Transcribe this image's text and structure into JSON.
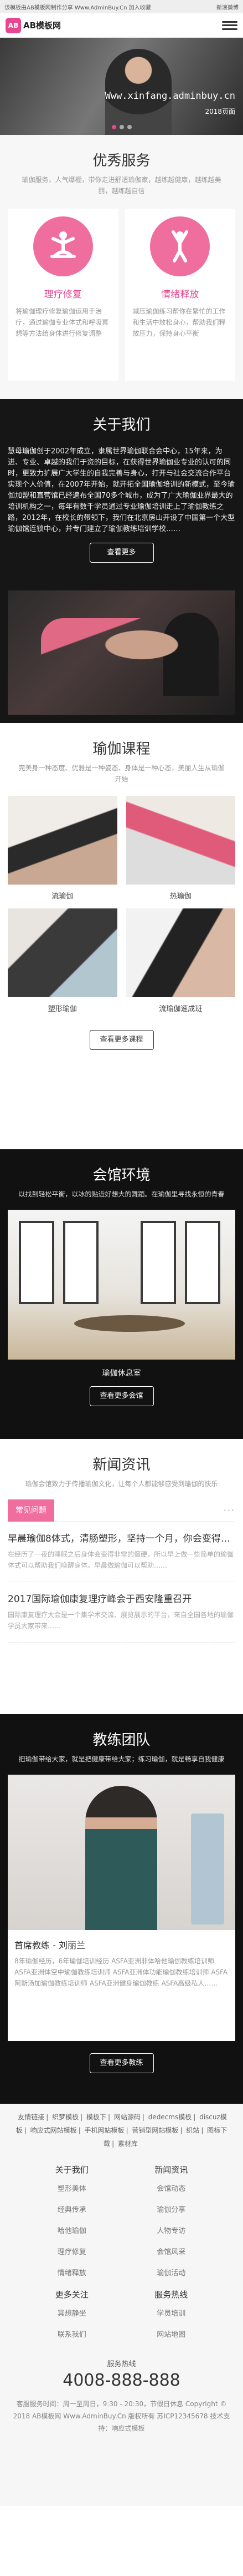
{
  "topbar": {
    "left": "该模板由AB模板网制作分享 Www.AdminBuy.Cn 加入收藏",
    "right": "新浪微博"
  },
  "header": {
    "logo_mark": "AB",
    "logo_text": "AB模板网"
  },
  "banner": {
    "url": "Www.xinfang.adminbuy.cn",
    "page": "2018页面"
  },
  "services": {
    "title": "优秀服务",
    "desc": "瑜伽服务，人气爆棚，带你走进舒适瑜伽家，越练越健康，越练越美丽，越练越自信",
    "items": [
      {
        "title": "理疗修复",
        "text": "将瑜伽理疗修复瑜伽运用于治疗，通过瑜伽专业体式和呼吸冥想等方法给身体进行修复调整"
      },
      {
        "title": "情绪释放",
        "text": "减压瑜伽练习帮你在繁忙的工作和生活中放松身心，帮助我们释放压力，保持身心平衡"
      }
    ]
  },
  "about": {
    "title": "关于我们",
    "text": "慧母瑜伽创于2002年成立，隶属世界瑜伽联合会中心，15年来，为进、专业、卓越的我们于资的目标，在获得世界瑜伽业专业的认可的同时，更致力扩展广大学生的自我完善与身心，打开与社会交流合作平台实现个人价值，在2007年开始，就开拓全国瑜伽培训的新模式，至今瑜伽加盟和直营馆已经遍布全国70多个城市，成为了广大瑜伽业界最大的培训机构之一，每年有数千学员通过专业瑜伽培训走上了瑜伽教练之路，2012年，在校长的带领下，我们在北京房山开设了中国第一个大型瑜伽馆连锁中心，并专门建立了瑜伽教练培训学校……",
    "button": "查看更多"
  },
  "courses": {
    "title": "瑜伽课程",
    "desc": "完美身一种态度、优雅是一种姿态、身体是一种心态，美丽人生从瑜伽开始",
    "items": [
      {
        "name": "流瑜伽"
      },
      {
        "name": "热瑜伽"
      },
      {
        "name": "塑形瑜伽"
      },
      {
        "name": "流瑜伽速成班"
      }
    ],
    "button": "查看更多课程"
  },
  "env": {
    "title": "会馆环境",
    "desc": "以找到轻松平衡，以冰的贴近好想大的舞蹈。在瑜伽里寻找永恒的青春",
    "caption": "瑜伽休息室",
    "button": "查看更多会馆"
  },
  "news": {
    "title": "新闻资讯",
    "desc": "瑜伽会馆致力于传播瑜伽文化，让每个人都能够感受到瑜伽的快乐",
    "tab": "常见问题",
    "more": "···",
    "items": [
      {
        "title": "早晨瑜伽8体式，清肠塑形，坚持一个月，你会变得更美",
        "desc": "在经历了一夜的睡眠之后身体会变得非常的僵硬，所以早上做一些简单的瑜伽体式可以帮助我们唤醒身体。早晨做瑜伽可以帮助……"
      },
      {
        "title": "2017国际瑜伽康复理疗峰会于西安隆重召开",
        "desc": "国际康复理疗大会是一个集学术交流、展览展示的平台，来自全国各地的瑜伽学员大家带来……"
      }
    ]
  },
  "team": {
    "title": "教练团队",
    "desc": "把瑜伽带给大家，就是把健康带给大家；练习瑜伽，就是畅享自我健康",
    "name": "首席教练 - 刘丽兰",
    "text": "8年瑜伽经历，6年瑜伽培训经历 ASFA亚洲非体哈他瑜伽教练培训师 ASFA亚洲体空中瑜伽教练培训师 ASFA亚洲体功能瑜伽教练培训师 ASFA阿斯汤加瑜伽教练培训师 ASFA亚洲健身瑜伽教练 ASFA高级私人……",
    "button": "查看更多教练"
  },
  "footer": {
    "links": [
      "友情链接",
      "织梦模板",
      "模板下",
      "网站源码",
      "dedecms模板",
      "discuz模板",
      "响应式网站模板",
      "手机网站模板",
      "营销型网站模板",
      "织站",
      "图标下载",
      "素材库"
    ],
    "cols": [
      {
        "head": "关于我们",
        "items": [
          "塑形美体",
          "经典传承",
          "哈他瑜伽",
          "理疗修复",
          "情绪释放",
          "冥想静坐",
          "联系我们"
        ]
      },
      {
        "head": "新闻资讯",
        "items": [
          "会馆动态",
          "瑜伽分享",
          "人物专访",
          "会馆风采",
          "瑜伽活动",
          "学员培训",
          "网站地图"
        ]
      }
    ],
    "extra_heads": [
      "服务热线",
      "更多关注"
    ],
    "hotline_title": "服务热线",
    "hotline": "4008-888-888",
    "copy": "客服服务时间：周一至周日，9:30 - 20:30，节假日休息 Copyright © 2018 AB模板网 Www.AdminBuy.Cn 版权所有 苏ICP12345678 技术支持：响应式模板"
  }
}
